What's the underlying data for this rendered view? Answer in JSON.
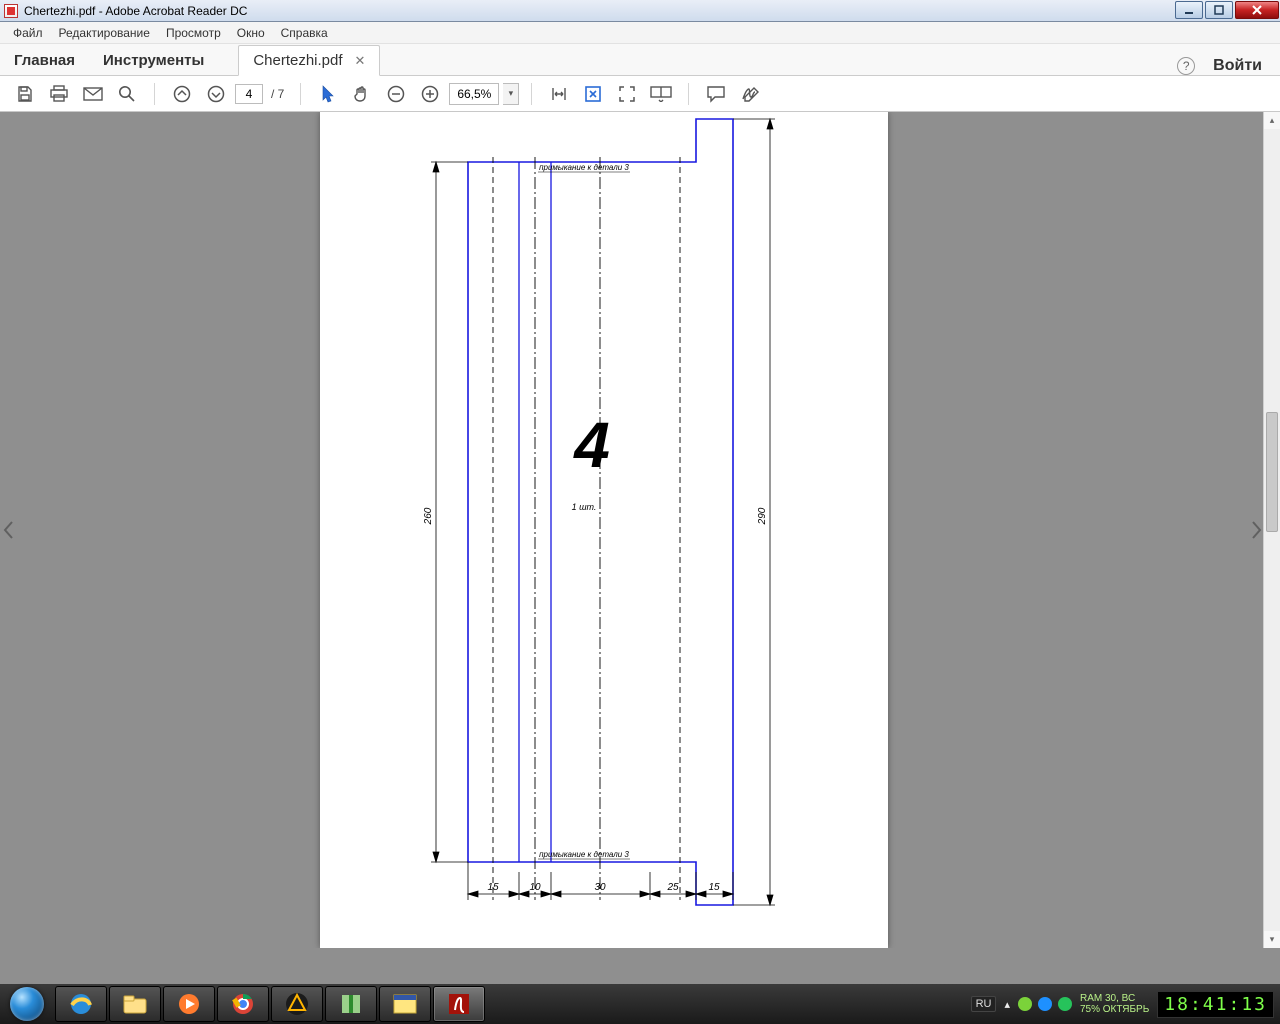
{
  "window": {
    "title": "Chertezhi.pdf - Adobe Acrobat Reader DC"
  },
  "menu": {
    "file": "Файл",
    "edit": "Редактирование",
    "view": "Просмотр",
    "window": "Окно",
    "help": "Справка"
  },
  "tabs": {
    "home": "Главная",
    "tools": "Инструменты",
    "file": "Chertezhi.pdf",
    "signin": "Войти"
  },
  "toolbar": {
    "page_current": "4",
    "page_total": "/ 7",
    "zoom": "66,5%"
  },
  "drawing": {
    "big_number": "4",
    "qty": "1 шт.",
    "note_top": "примыкание к детали 3",
    "note_bottom": "примыкание к детали 3",
    "height_left": "260",
    "height_right": "290",
    "dims_bottom": [
      "15",
      "10",
      "30",
      "25",
      "15"
    ]
  },
  "taskbar": {
    "lang": "RU",
    "sys_line1": "RAM   30, ВС",
    "sys_line2": "75%  ОКТЯБРЬ",
    "clock": "18:41:13"
  }
}
